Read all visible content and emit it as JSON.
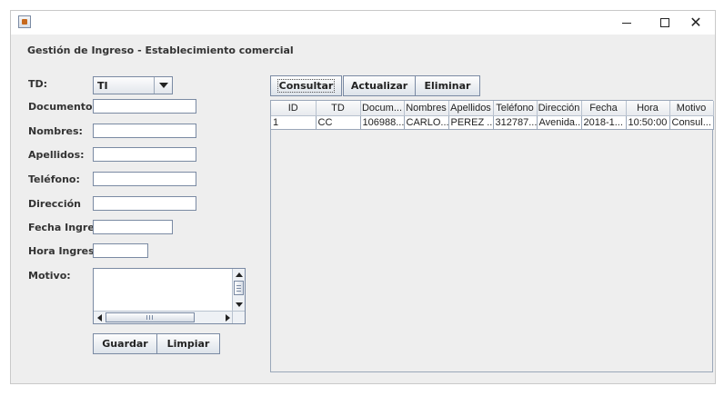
{
  "window": {
    "title": "",
    "controls": {
      "minimize": "—",
      "maximize": "☐",
      "close": "✕"
    }
  },
  "form": {
    "heading": "Gestión de Ingreso - Establecimiento comercial",
    "labels": {
      "td": "TD:",
      "documento": "Documento:",
      "nombres": "Nombres:",
      "apellidos": "Apellidos:",
      "telefono": "Teléfono:",
      "direccion": "Dirección",
      "fecha": "Fecha Ingre...",
      "hora": "Hora Ingreso:",
      "motivo": "Motivo:"
    },
    "values": {
      "td": "TI",
      "documento": "",
      "nombres": "",
      "apellidos": "",
      "telefono": "",
      "direccion": "",
      "fecha": "",
      "hora": "",
      "motivo": ""
    },
    "buttons": {
      "guardar": "Guardar",
      "limpiar": "Limpiar"
    }
  },
  "toolbar": {
    "consultar": "Consultar",
    "actualizar": "Actualizar",
    "eliminar": "Eliminar"
  },
  "table": {
    "columns": [
      "ID",
      "TD",
      "Docum...",
      "Nombres",
      "Apellidos",
      "Teléfono",
      "Dirección",
      "Fecha",
      "Hora",
      "Motivo"
    ],
    "rows": [
      [
        "1",
        "CC",
        "106988...",
        "CARLO...",
        "PEREZ ...",
        "312787...",
        "Avenida...",
        "2018-1...",
        "10:50:00",
        "Consul..."
      ]
    ]
  },
  "colors": {
    "panel_bg": "#eeeeee",
    "field_border": "#7a8aa3",
    "button_gradient_top": "#fdfdfd",
    "button_gradient_bottom": "#dde3ea"
  }
}
